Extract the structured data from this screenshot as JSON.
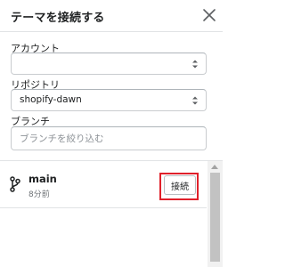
{
  "header": {
    "title": "テーマを接続する",
    "close_icon": "close-icon"
  },
  "form": {
    "account": {
      "label": "アカウント",
      "value": ""
    },
    "repository": {
      "label": "リポジトリ",
      "value": "shopify-dawn"
    },
    "branch": {
      "label": "ブランチ",
      "placeholder": "ブランチを絞り込む",
      "value": ""
    }
  },
  "branches": [
    {
      "name": "main",
      "time": "8分前",
      "icon": "branch-icon",
      "action_label": "接続"
    }
  ],
  "colors": {
    "highlight": "#e0202a",
    "text": "#202223",
    "muted": "#6d7175",
    "border": "#c9cccf"
  }
}
